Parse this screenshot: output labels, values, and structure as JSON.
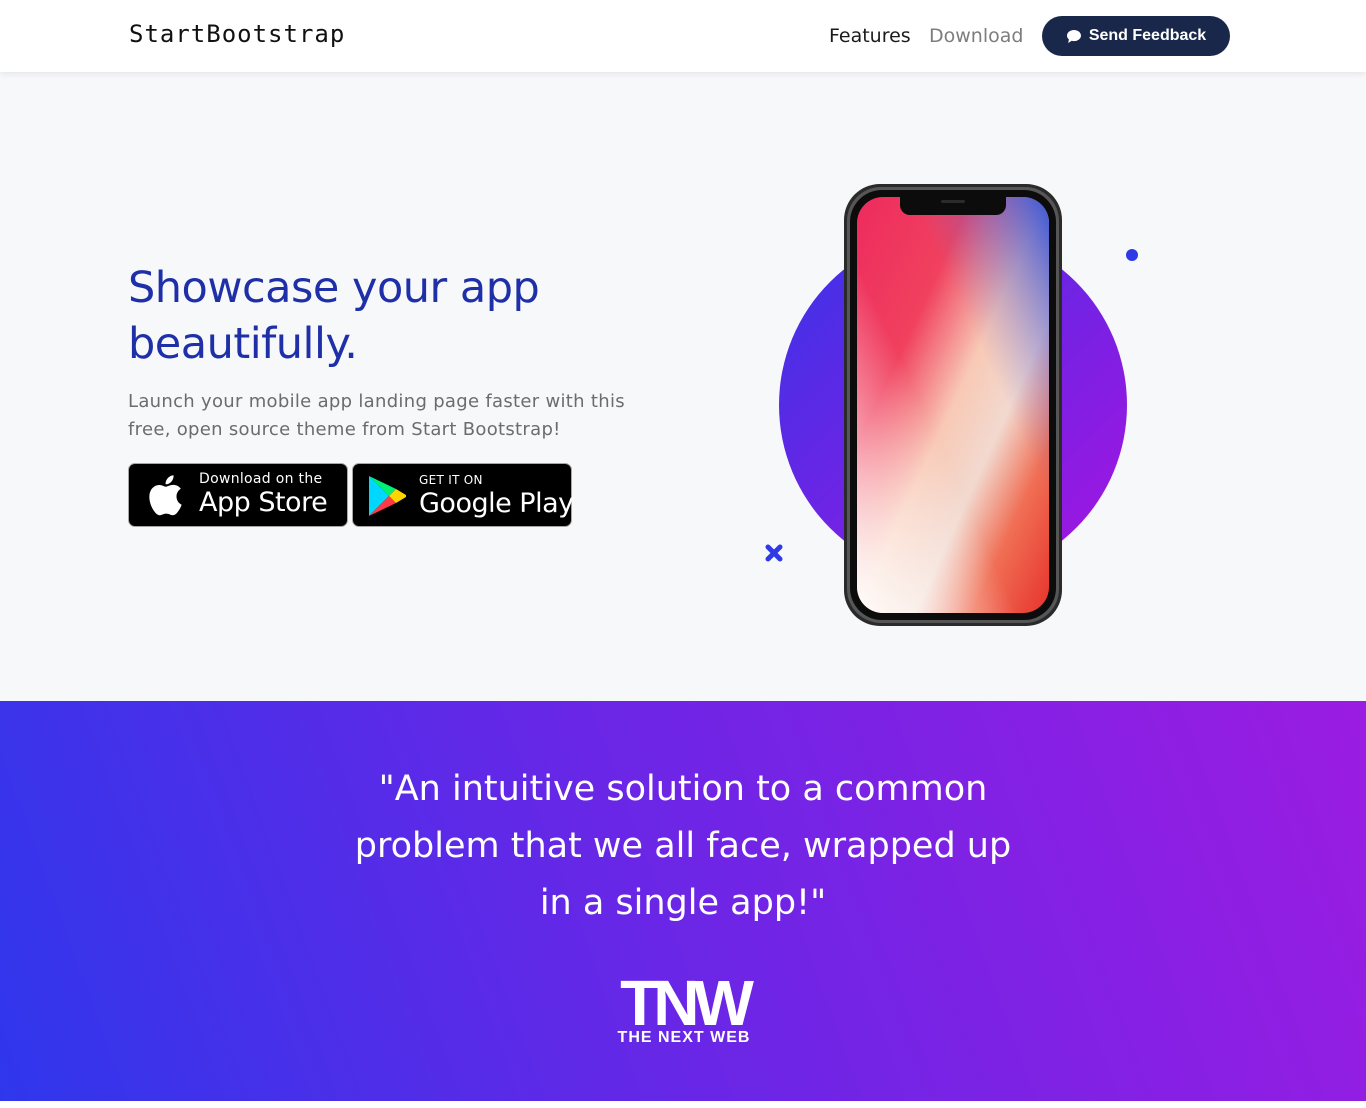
{
  "navbar": {
    "brand": "StartBootstrap",
    "links": [
      "Features",
      "Download"
    ],
    "feedback_button": "Send Feedback"
  },
  "hero": {
    "headline_line1": "Showcase your app",
    "headline_line2": "beautifully.",
    "subtext_line1": "Launch your mobile app landing page faster with this",
    "subtext_line2": "free, open source theme from Start Bootstrap!",
    "apple_badge": {
      "small": "Download on the",
      "large": "App Store"
    },
    "google_badge": {
      "small": "GET IT ON",
      "large": "Google Play"
    }
  },
  "testimonial": {
    "quote_line1": "\"An intuitive solution to a common",
    "quote_line2": "problem that we all face, wrapped up",
    "quote_line3": "in a single app!\"",
    "logo_mark": "TNW",
    "logo_caption": "THE NEXT WEB"
  },
  "colors": {
    "headline": "#1e2fa8",
    "button_dark": "#18274a",
    "gradient_start": "#2f37ec",
    "gradient_end": "#9b1ce2"
  }
}
